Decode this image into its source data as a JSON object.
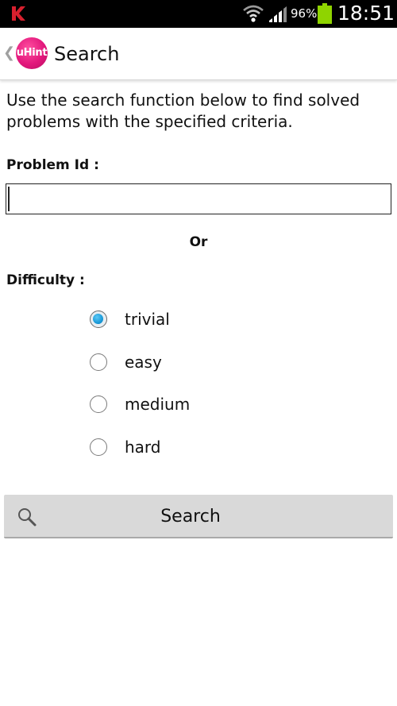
{
  "status_bar": {
    "battery_percent": "96%",
    "time": "18:51",
    "icons": [
      "kaspersky-k-icon",
      "wifi-icon",
      "signal-icon",
      "battery-icon"
    ],
    "battery_color": "#8fd400"
  },
  "action_bar": {
    "logo_text": "uHint",
    "title": "Search",
    "logo_color": "#e3177c"
  },
  "content": {
    "intro": "Use the search function below to find solved problems with the specified criteria.",
    "problem_id_label": "Problem Id :",
    "problem_id_value": "",
    "problem_id_placeholder": "",
    "or_label": "Or",
    "difficulty_label": "Difficulty :",
    "difficulty_options": [
      {
        "label": "trivial",
        "checked": true
      },
      {
        "label": "easy",
        "checked": false
      },
      {
        "label": "medium",
        "checked": false
      },
      {
        "label": "hard",
        "checked": false
      }
    ],
    "search_button_label": "Search",
    "radio_accent": "#1a9ad8"
  }
}
